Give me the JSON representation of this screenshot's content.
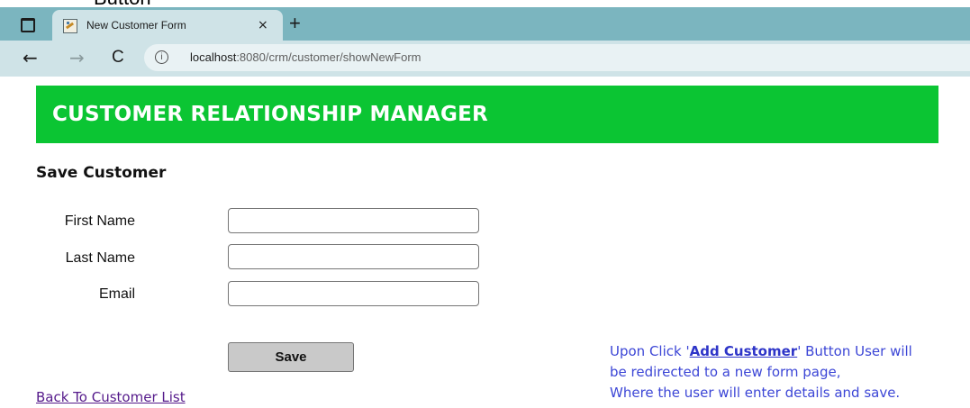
{
  "cut_text": "Button",
  "browser": {
    "tab_title": "New Customer Form",
    "tab_close": "×",
    "new_tab": "+",
    "url_host": "localhost",
    "url_rest": ":8080/crm/customer/showNewForm",
    "back": "←",
    "forward": "→",
    "reload": "C",
    "info": "i"
  },
  "header": {
    "title": "CUSTOMER RELATIONSHIP MANAGER",
    "bg_color": "#0bc533"
  },
  "form": {
    "heading": "Save Customer",
    "fields": [
      {
        "label": "First Name",
        "value": ""
      },
      {
        "label": "Last Name",
        "value": ""
      },
      {
        "label": "Email",
        "value": ""
      }
    ],
    "save_label": "Save"
  },
  "back_link": "Back To Customer List",
  "note": {
    "line1_pre": "Upon Click '",
    "line1_strong": "Add Customer",
    "line1_post": "' Button User will",
    "line2": "be redirected to a new form page,",
    "line3": "Where the user will enter details and save.",
    "color": "#3c46d6"
  }
}
